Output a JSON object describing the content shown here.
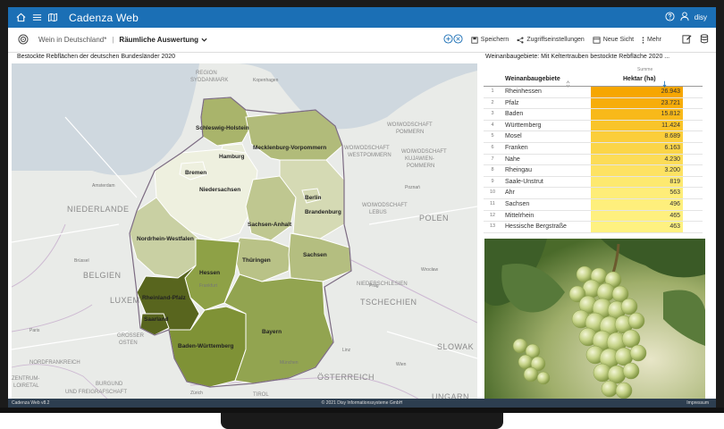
{
  "app": {
    "title": "Cadenza Web",
    "user": "disy"
  },
  "toolbar": {
    "breadcrumb_parent": "Wein in Deutschland*",
    "breadcrumb_current": "Räumliche Auswertung",
    "save": "Speichern",
    "access": "Zugriffseinstellungen",
    "new_view": "Neue Sicht",
    "more": "Mehr"
  },
  "map": {
    "title": "Bestockte Rebflächen der deutschen Bundesländer 2020",
    "states": {
      "sh": "Schleswig-Holstein",
      "mv": "Mecklenburg-Vorpommern",
      "hh": "Hamburg",
      "hb": "Bremen",
      "ni": "Niedersachsen",
      "be": "Berlin",
      "bb": "Brandenburg",
      "st": "Sachsen-Anhalt",
      "nw": "Nordrhein-Westfalen",
      "th": "Thüringen",
      "sn": "Sachsen",
      "he": "Hessen",
      "rp": "Rheinland-Pfalz",
      "sl": "Saarland",
      "bw": "Baden-Württemberg",
      "by": "Bayern"
    },
    "basemap": {
      "region": "REGION",
      "syddanmark": "SYDDANMARK",
      "woiw1": "WOIWODSCHAFT",
      "pommern": "POMMERN",
      "woiw2": "WOIWODSCHAFT",
      "westpommern": "WESTPOMMERN",
      "woiw3": "WOIWODSCHAFT",
      "kujawien": "KUJAWIEN-",
      "pommern2": "POMMERN",
      "niederlande": "NIEDERLANDE",
      "polen": "POLEN",
      "woiw4": "WOIWODSCHAFT",
      "lebus": "LEBUS",
      "belgien": "BELGIEN",
      "niederschlesien": "NIEDERSCHLESIEN",
      "nordfrankreich": "NORDFRANKREICH",
      "luxemburg": "LUXEM",
      "tschechien": "TSCHECHIEN",
      "grosser": "GROSSER",
      "osten": "OSTEN",
      "slowak": "SLOWAK",
      "zentrum": "ZENTRUM-",
      "loiretal": "LOIRETAL",
      "burgund": "BURGUND",
      "freigrafschaft": "UND FREIGRAFSCHAFT",
      "oesterreich": "ÖSTERREICH",
      "tirol": "TIROL",
      "ungarn": "UNGARN",
      "kopenhagen": "Kopenhagen",
      "poznan": "Poznań",
      "prag": "Prag",
      "wroclaw": "Wrocław",
      "wien": "Wien",
      "munchen": "München",
      "frankfurt": "Frankfurt",
      "amsterdam": "Amsterdam",
      "brussel": "Brüssel",
      "paris": "Paris",
      "zurich": "Zürich",
      "linz": "Linz"
    }
  },
  "table": {
    "title": "Weinanbaugebiete: Mit Keltertrauben bestockte Rebfläche 2020 ...",
    "col1": "Weinanbaugebiete",
    "col2_sub": "Summe",
    "col2": "Hektar (ha)",
    "rows": [
      {
        "n": "1",
        "name": "Rheinhessen",
        "value": "26.943"
      },
      {
        "n": "2",
        "name": "Pfalz",
        "value": "23.721"
      },
      {
        "n": "3",
        "name": "Baden",
        "value": "15.812"
      },
      {
        "n": "4",
        "name": "Württemberg",
        "value": "11.424"
      },
      {
        "n": "5",
        "name": "Mosel",
        "value": "8.689"
      },
      {
        "n": "6",
        "name": "Franken",
        "value": "6.163"
      },
      {
        "n": "7",
        "name": "Nahe",
        "value": "4.230"
      },
      {
        "n": "8",
        "name": "Rheingau",
        "value": "3.200"
      },
      {
        "n": "9",
        "name": "Saale-Unstrut",
        "value": "819"
      },
      {
        "n": "10",
        "name": "Ahr",
        "value": "563"
      },
      {
        "n": "11",
        "name": "Sachsen",
        "value": "496"
      },
      {
        "n": "12",
        "name": "Mittelrhein",
        "value": "465"
      },
      {
        "n": "13",
        "name": "Hessische Bergstraße",
        "value": "463"
      }
    ],
    "heat_colors": [
      "#f6a600",
      "#f7ad0a",
      "#f8b91a",
      "#f9c42a",
      "#fbce3b",
      "#fbd548",
      "#fcdc57",
      "#fde263",
      "#fde96f",
      "#feed78",
      "#feef7c",
      "#fef07f",
      "#fef181"
    ]
  },
  "footer": {
    "version": "Cadenza Web v8.2",
    "copyright": "© 2021 Disy Informationssysteme GmbH",
    "impressum": "Impressum"
  },
  "colors": {
    "appbar": "#1b6fb5",
    "footer": "#2d3e50"
  }
}
